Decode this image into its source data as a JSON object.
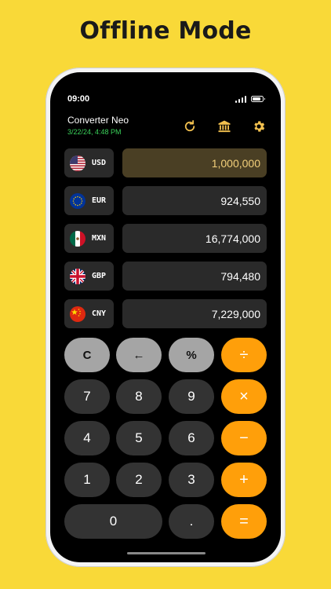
{
  "headline": "Offline Mode",
  "status_bar": {
    "time": "09:00"
  },
  "app": {
    "title": "Converter Neo",
    "updated": "3/22/24, 4:48 PM"
  },
  "toolbar": {
    "refresh_icon": "refresh-icon",
    "bank_icon": "bank-icon",
    "settings_icon": "gear-icon"
  },
  "currencies": [
    {
      "code": "USD",
      "amount": "1,000,000",
      "flag": "us-flag-icon",
      "active": true
    },
    {
      "code": "EUR",
      "amount": "924,550",
      "flag": "eu-flag-icon",
      "active": false
    },
    {
      "code": "MXN",
      "amount": "16,774,000",
      "flag": "mx-flag-icon",
      "active": false
    },
    {
      "code": "GBP",
      "amount": "794,480",
      "flag": "gb-flag-icon",
      "active": false
    },
    {
      "code": "CNY",
      "amount": "7,229,000",
      "flag": "cn-flag-icon",
      "active": false
    }
  ],
  "keypad": {
    "clear": "C",
    "backspace": "←",
    "percent": "%",
    "divide": "÷",
    "seven": "7",
    "eight": "8",
    "nine": "9",
    "multiply": "×",
    "four": "4",
    "five": "5",
    "six": "6",
    "minus": "−",
    "one": "1",
    "two": "2",
    "three": "3",
    "plus": "+",
    "zero": "0",
    "decimal": ".",
    "equals": "="
  },
  "colors": {
    "background": "#f9d938",
    "accent": "#ff9f0a",
    "active_field": "#4a3f24",
    "active_text": "#f2cf7a",
    "date_green": "#3ad25a",
    "toolbar_icon": "#f3c14f"
  }
}
